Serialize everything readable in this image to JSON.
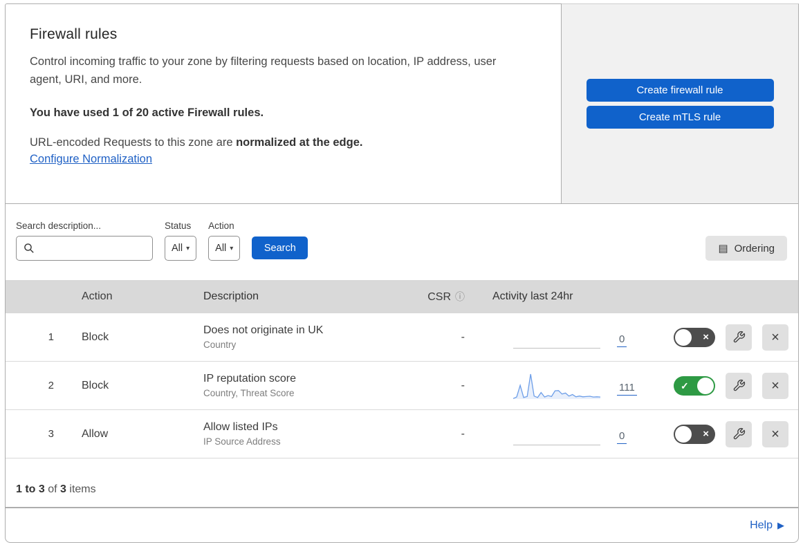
{
  "header": {
    "title": "Firewall rules",
    "description": "Control incoming traffic to your zone by filtering requests based on location, IP address, user agent, URI, and more.",
    "usage_line": "You have used 1 of 20 active Firewall rules.",
    "normalization_prefix": "URL-encoded Requests to this zone are ",
    "normalization_bold": "normalized at the edge.",
    "normalization_link": "Configure Normalization",
    "create_firewall_button": "Create firewall rule",
    "create_mtls_button": "Create mTLS rule"
  },
  "filters": {
    "search_label": "Search description...",
    "search_value": "",
    "status_label": "Status",
    "status_value": "All",
    "action_label": "Action",
    "action_value": "All",
    "search_button": "Search",
    "ordering_button": "Ordering"
  },
  "table": {
    "columns": {
      "action": "Action",
      "description": "Description",
      "csr": "CSR",
      "activity": "Activity last 24hr"
    },
    "rows": [
      {
        "num": "1",
        "action": "Block",
        "title": "Does not originate in UK",
        "subtitle": "Country",
        "csr": "-",
        "count": "0",
        "enabled": false,
        "has_sparkline": false
      },
      {
        "num": "2",
        "action": "Block",
        "title": "IP reputation score",
        "subtitle": "Country, Threat Score",
        "csr": "-",
        "count": "111",
        "enabled": true,
        "has_sparkline": true
      },
      {
        "num": "3",
        "action": "Allow",
        "title": "Allow listed IPs",
        "subtitle": "IP Source Address",
        "csr": "-",
        "count": "0",
        "enabled": false,
        "has_sparkline": false
      }
    ]
  },
  "footer": {
    "range": "1 to 3",
    "of": " of ",
    "total": "3",
    "items_label": " items",
    "help_label": "Help"
  },
  "icons": {
    "ordering": "▤",
    "caret": "▾",
    "info": "ⓘ",
    "check": "✓",
    "cross": "×",
    "close": "×",
    "help_arrow": "▶"
  },
  "colors": {
    "primary_blue": "#1062cb",
    "link_blue": "#2061c5",
    "toggle_on": "#2e9a44",
    "toggle_off": "#4d4d4d",
    "sparkline": "#6d9ee8",
    "header_gray": "#d9d9d9",
    "panel_gray": "#f1f1f1"
  },
  "chart_data": {
    "type": "line",
    "title": "Activity last 24hr sparkline (rule 2)",
    "x": "24h window, evenly spaced samples",
    "values": [
      2,
      8,
      55,
      6,
      10,
      100,
      12,
      6,
      26,
      8,
      14,
      10,
      33,
      34,
      20,
      24,
      12,
      18,
      9,
      12,
      9,
      10,
      11,
      8,
      9,
      8
    ],
    "ylim": [
      0,
      100
    ],
    "total_events": 111
  }
}
